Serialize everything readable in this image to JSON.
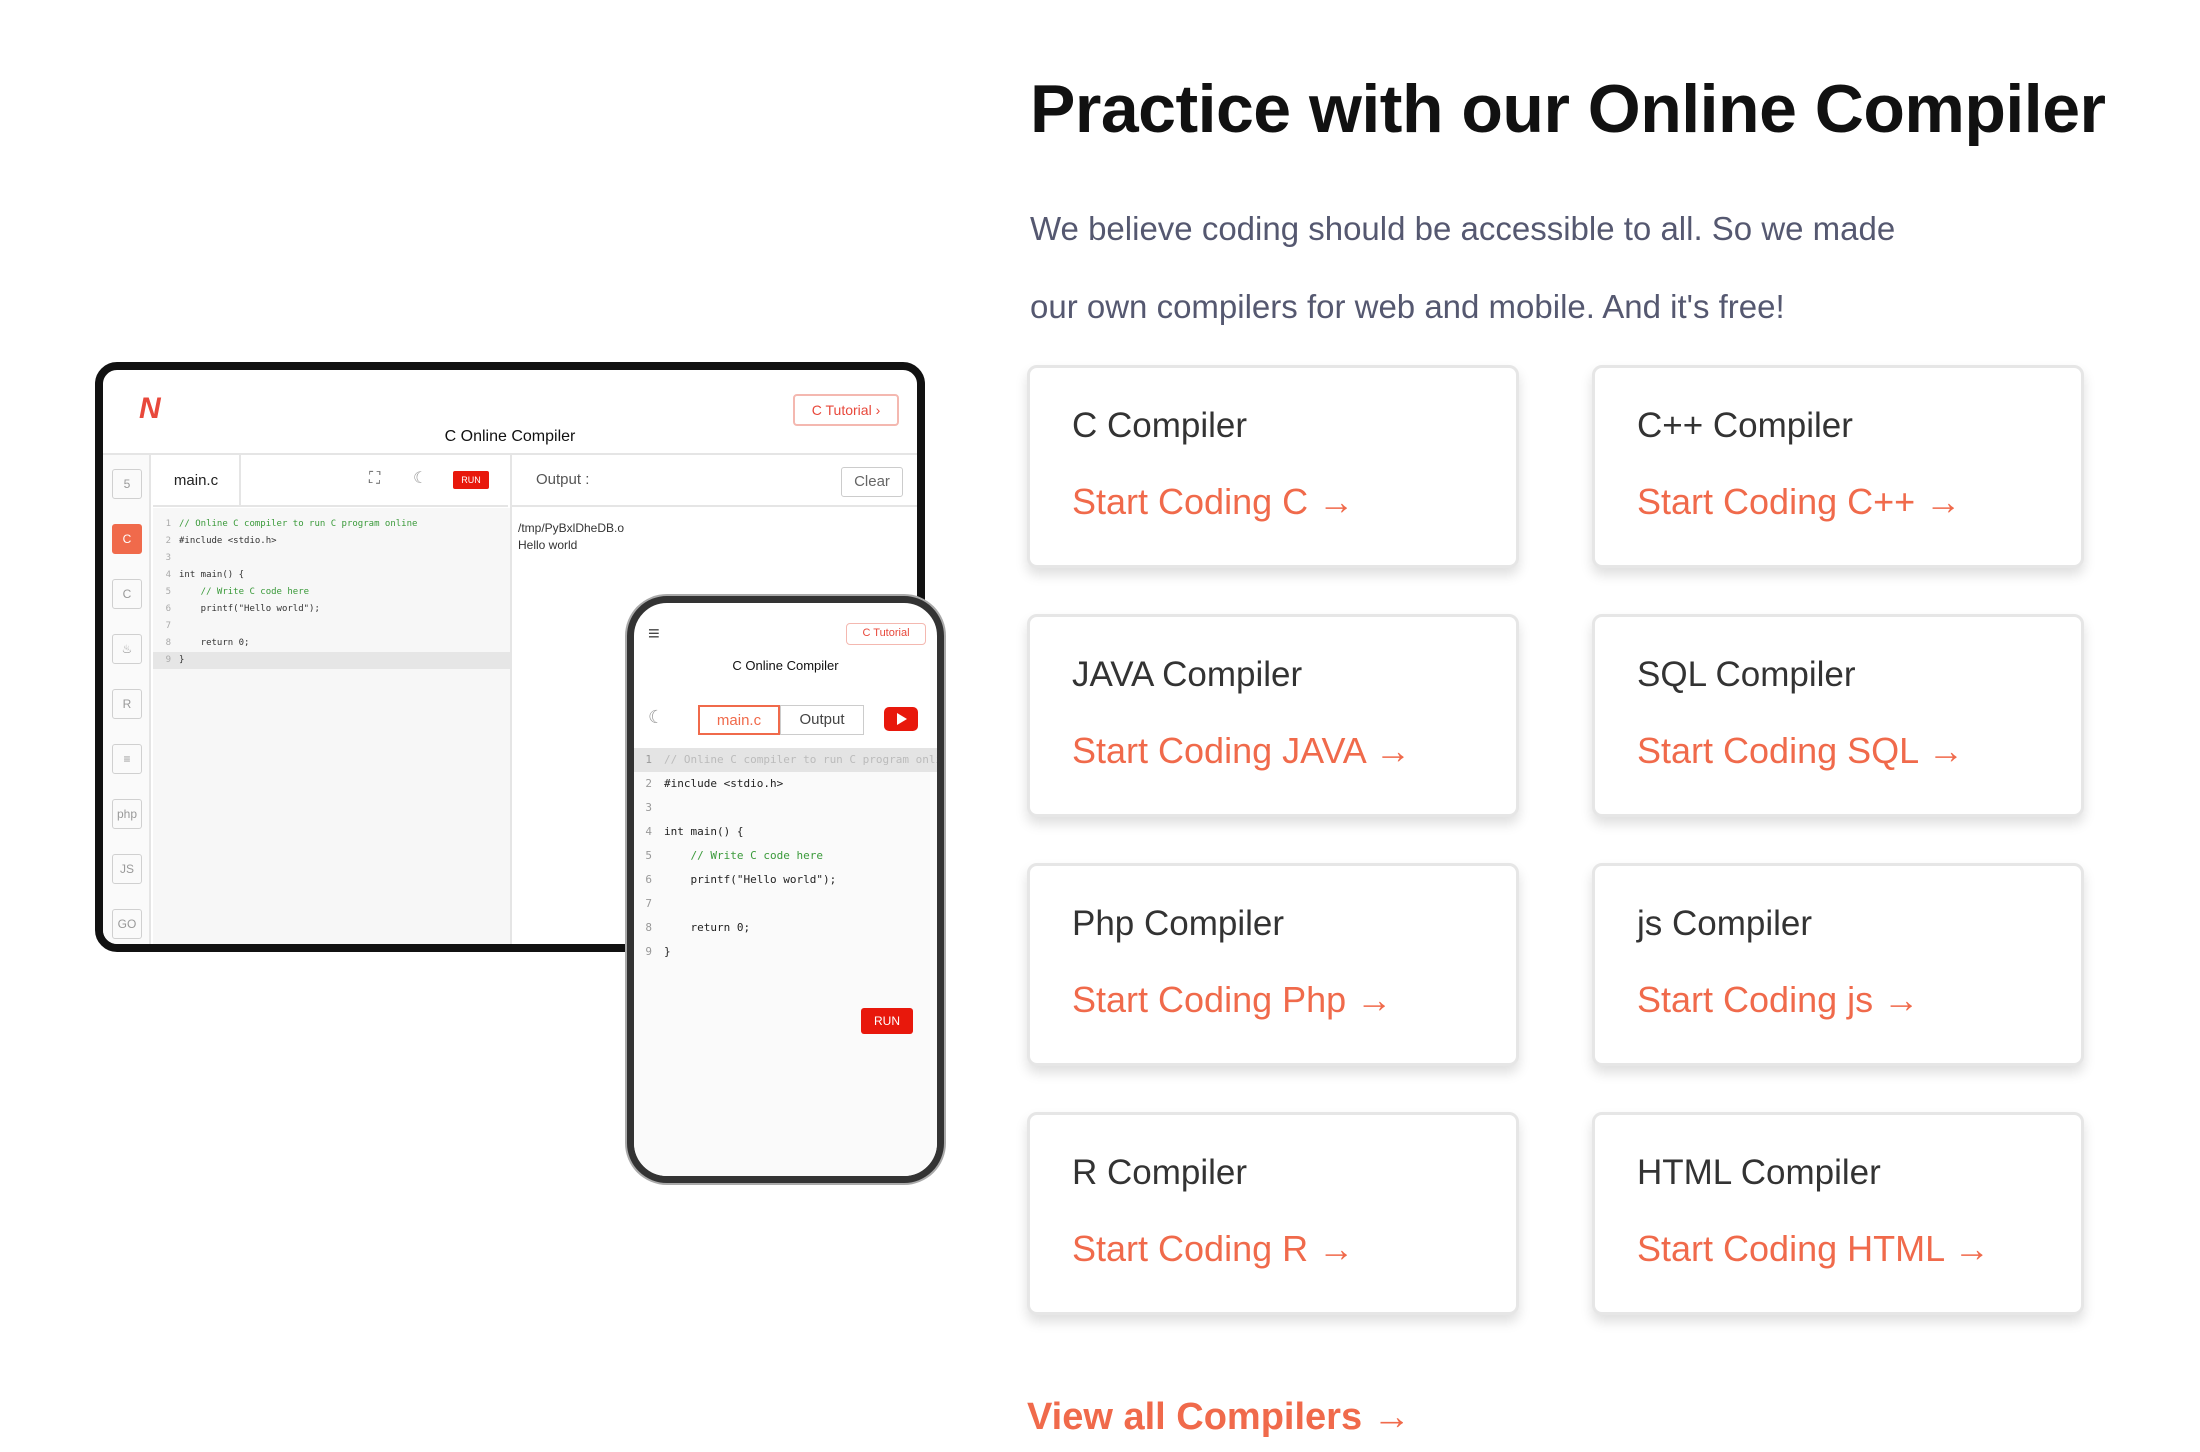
{
  "heading": "Practice with our Online Compiler",
  "lead": [
    "We believe coding should be accessible to all. So we made",
    "our own compilers for web and mobile. And it's free!"
  ],
  "cards": [
    {
      "title": "C Compiler",
      "link": "Start Coding C →"
    },
    {
      "title": "C++ Compiler",
      "link": "Start Coding C++ →"
    },
    {
      "title": "JAVA Compiler",
      "link": "Start Coding JAVA →"
    },
    {
      "title": "SQL Compiler",
      "link": "Start Coding SQL →"
    },
    {
      "title": "Php Compiler",
      "link": "Start Coding Php →"
    },
    {
      "title": "js Compiler",
      "link": "Start Coding js →"
    },
    {
      "title": "R Compiler",
      "link": "Start Coding R →"
    },
    {
      "title": "HTML Compiler",
      "link": "Start Coding HTML →"
    }
  ],
  "view_all": "View all Compilers →",
  "tablet": {
    "logo": "N",
    "title": "C Online Compiler",
    "tutorial": "C Tutorial  ›",
    "file_tab": "main.c",
    "run": "RUN",
    "output_label": "Output :",
    "clear": "Clear",
    "sidebar": [
      "5",
      "C",
      "C",
      "♨",
      "R",
      "≡",
      "php",
      "JS",
      "GO"
    ],
    "output_lines": [
      "/tmp/PyBxlDheDB.o",
      "Hello world"
    ]
  },
  "phone": {
    "title": "C Online Compiler",
    "tutorial": "C Tutorial",
    "tab_main": "main.c",
    "tab_output": "Output",
    "run": "RUN"
  },
  "code_lines": [
    {
      "n": "1",
      "text": "// Online C compiler to run C program online"
    },
    {
      "n": "2",
      "text": "#include <stdio.h>"
    },
    {
      "n": "3",
      "text": ""
    },
    {
      "n": "4",
      "text": "int main() {"
    },
    {
      "n": "5",
      "text": "    // Write C code here"
    },
    {
      "n": "6",
      "text": "    printf(\"Hello world\");"
    },
    {
      "n": "7",
      "text": ""
    },
    {
      "n": "8",
      "text": "    return 0;"
    },
    {
      "n": "9",
      "text": "}"
    }
  ],
  "colors": {
    "accent": "#f06a4b",
    "run_red": "#e8180c"
  }
}
